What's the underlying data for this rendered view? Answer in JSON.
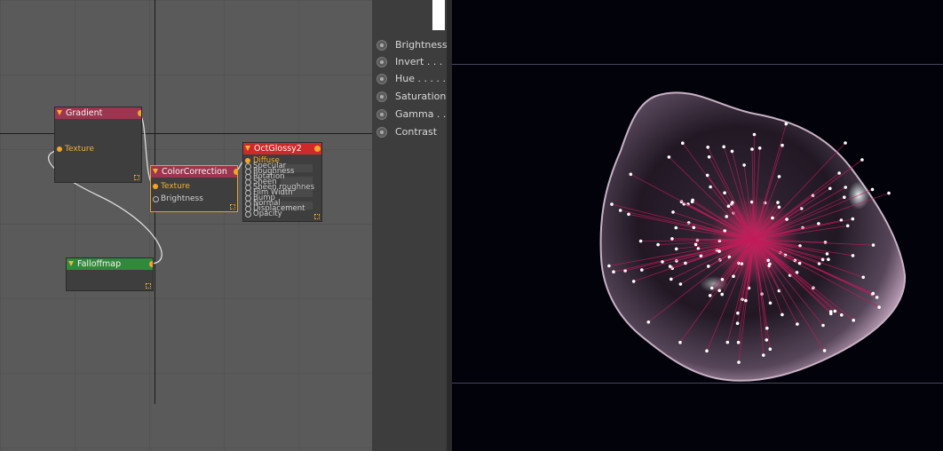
{
  "node_editor": {
    "nodes": {
      "gradient": {
        "title": "Gradient",
        "header_color": "#9c3550",
        "ports": [
          "Texture"
        ]
      },
      "color_correction": {
        "title": "ColorCorrection",
        "header_color": "#9c3550",
        "ports": [
          "Texture",
          "Brightness"
        ]
      },
      "oct_glossy": {
        "title": "OctGlossy2",
        "header_color": "#cf2a2a",
        "ports": [
          "Diffuse",
          "Specular",
          "Roughness",
          "Rotation",
          "Sheen",
          "Sheen roughnes",
          "Film Width",
          "Bump",
          "Normal",
          "Displacement",
          "Opacity"
        ]
      },
      "falloffmap": {
        "title": "Falloffmap",
        "header_color": "#2f8a3e",
        "ports": []
      }
    }
  },
  "attributes": {
    "items": [
      "Brightness",
      "Invert . . . .",
      "Hue . . . . .",
      "Saturation",
      "Gamma . .",
      "Contrast"
    ]
  },
  "viewport": {
    "background": "#02020b",
    "accent_strand": "#c21c5a",
    "blob_color": "#c8aac4"
  }
}
